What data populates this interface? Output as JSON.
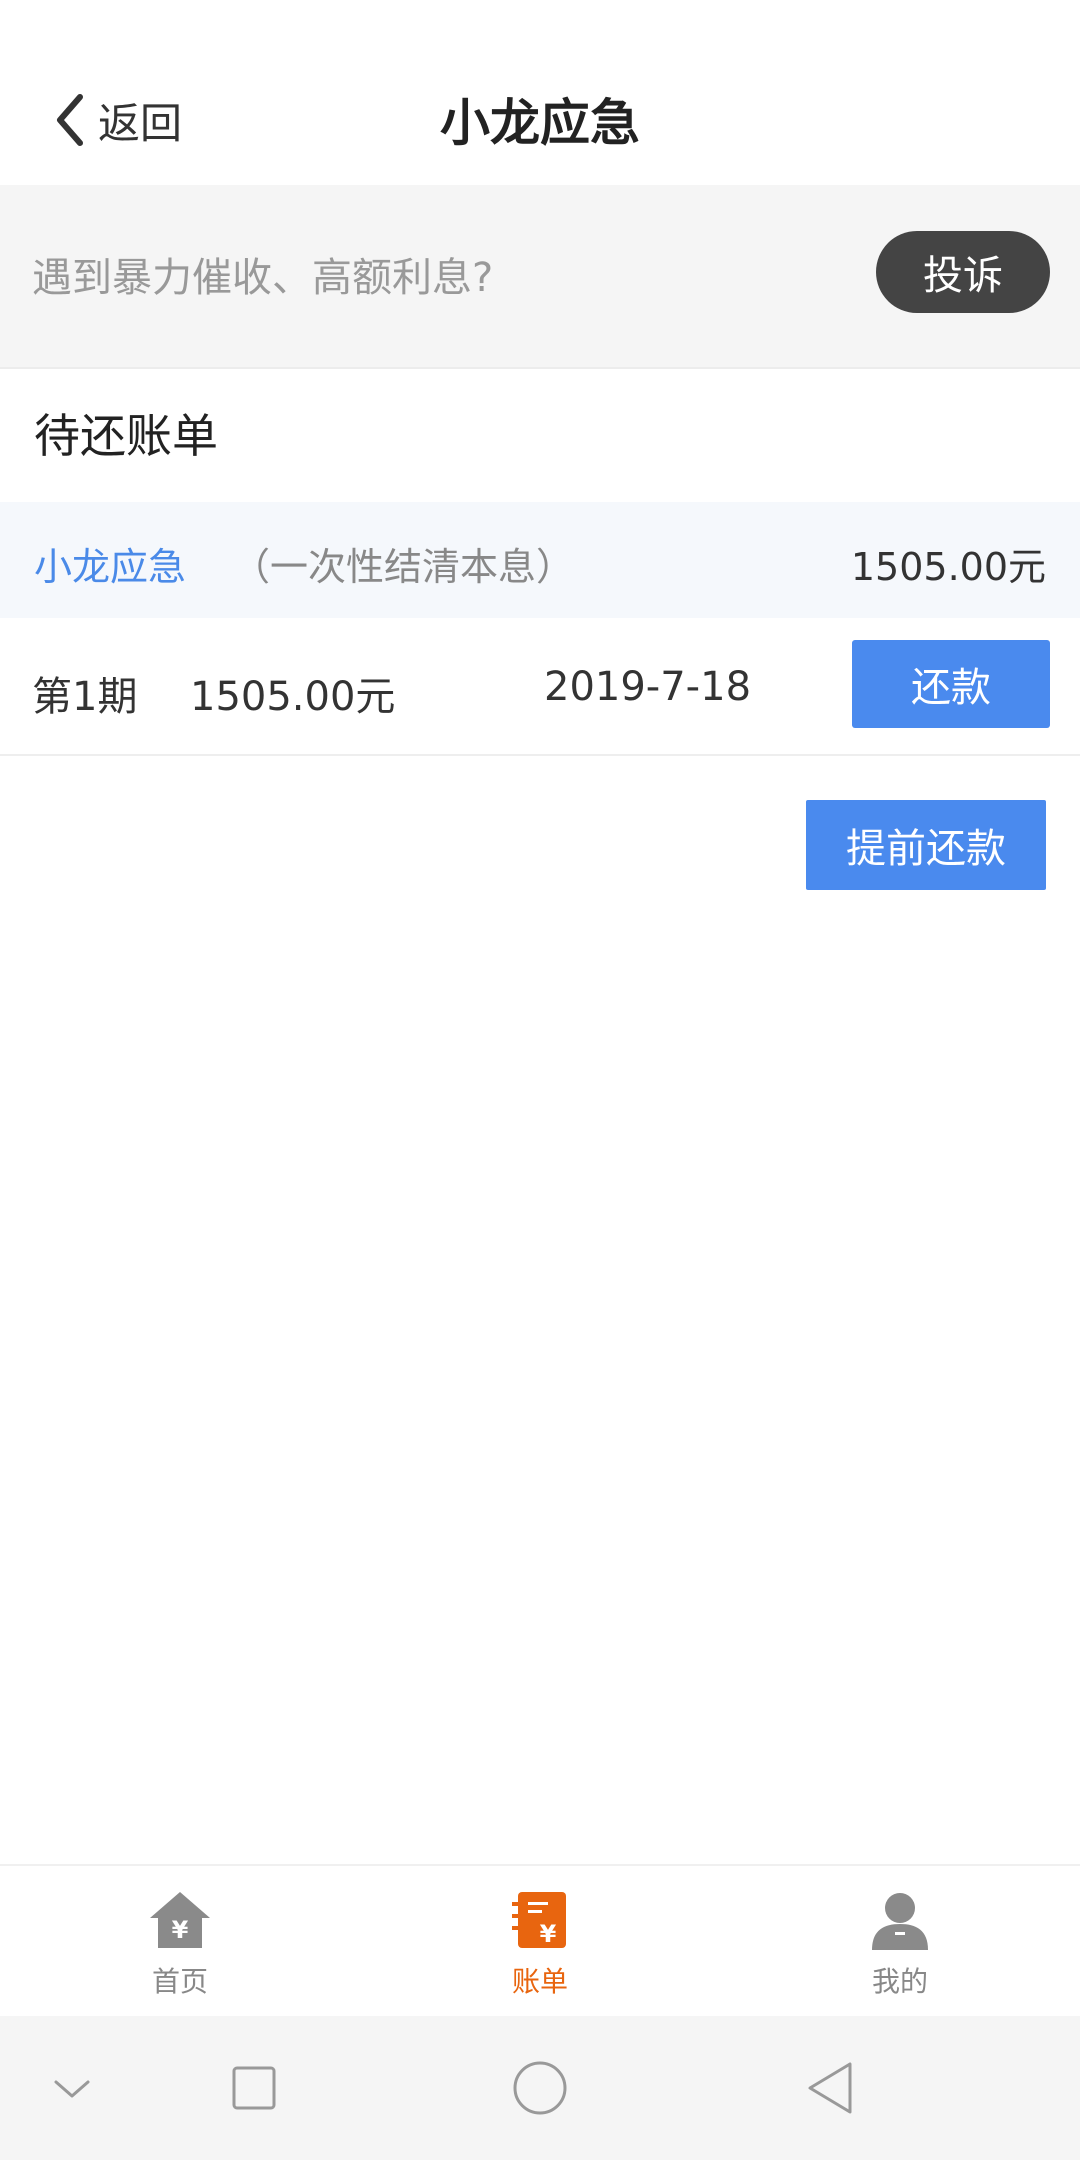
{
  "header": {
    "back_label": "返回",
    "title": "小龙应急"
  },
  "notice": {
    "text": "遇到暴力催收、高额利息?",
    "complain_label": "投诉"
  },
  "bills": {
    "section_title": "待还账单",
    "loan": {
      "name": "小龙应急",
      "type": "（一次性结清本息）",
      "amount": "1505.00元"
    },
    "installments": [
      {
        "period": "第1期",
        "amount": "1505.00元",
        "date": "2019-7-18",
        "repay_label": "还款"
      }
    ],
    "early_repay_label": "提前还款"
  },
  "tabbar": {
    "items": [
      {
        "label": "首页",
        "icon": "home-yen-icon",
        "active": false
      },
      {
        "label": "账单",
        "icon": "bill-yen-icon",
        "active": true
      },
      {
        "label": "我的",
        "icon": "user-icon",
        "active": false
      }
    ]
  },
  "colors": {
    "accent_blue": "#4a8aee",
    "active_orange": "#e8650f",
    "complain_dark": "#444444"
  }
}
